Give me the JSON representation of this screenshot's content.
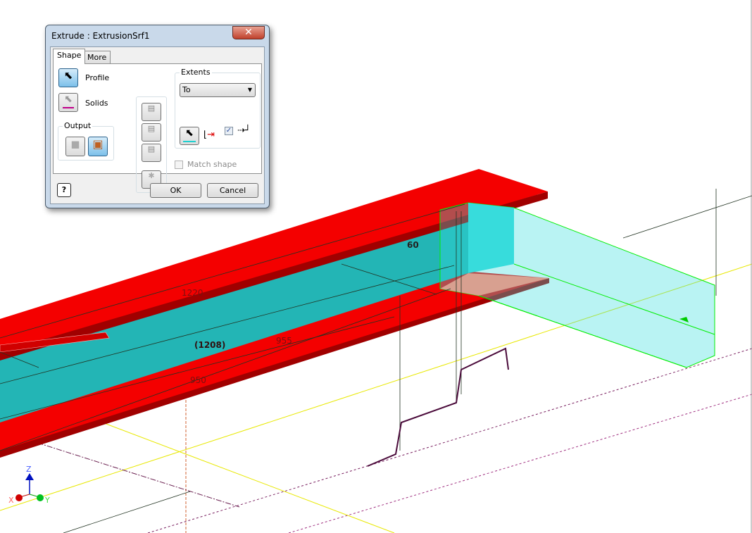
{
  "dialog": {
    "title": "Extrude : ExtrusionSrf1",
    "close_label": "✕",
    "tabs": [
      {
        "label": "Shape",
        "active": true
      },
      {
        "label": "More",
        "active": false
      }
    ],
    "profile_label": "Profile",
    "solids_label": "Solids",
    "output_label": "Output",
    "extents_label": "Extents",
    "extents_value": "To",
    "extend_checkbox_checked": true,
    "match_shape_label": "Match shape",
    "match_shape_checked": false,
    "ok_label": "OK",
    "cancel_label": "Cancel",
    "help_label": "?"
  },
  "viewport": {
    "dimensions": [
      "1220",
      "60",
      "(1208)",
      "955",
      "950"
    ],
    "axes": {
      "x": "X",
      "y": "Y",
      "z": "Z"
    },
    "colors": {
      "flange": "#f40000",
      "web": "#23b5b5",
      "preview": "#37dcdc",
      "edge_highlight": "#00ff00",
      "sketch": "#4a0a3a",
      "axis_yellow": "#f0f000"
    }
  }
}
